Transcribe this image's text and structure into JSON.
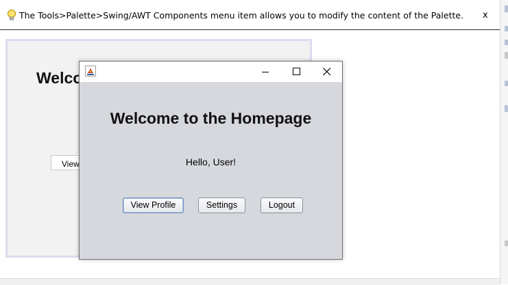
{
  "hint": {
    "text": "The Tools>Palette>Swing/AWT Components menu item allows you to modify the content of the Palette.",
    "close_label": "x"
  },
  "designer": {
    "title_partial": "Welco",
    "button_partial": "View"
  },
  "window": {
    "heading": "Welcome to the Homepage",
    "greeting": "Hello, User!",
    "buttons": {
      "view_profile": "View Profile",
      "settings": "Settings",
      "logout": "Logout"
    }
  },
  "colors": {
    "content_bg": "#d6d8de",
    "design_border": "#dcdcf0",
    "focus_border": "#6f8db7"
  }
}
